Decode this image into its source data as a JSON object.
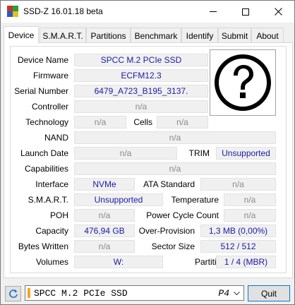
{
  "window": {
    "title": "SSD-Z 16.01.18 beta",
    "icon_colors": [
      "#c0392b",
      "#2e9e3a",
      "#2b5bc0",
      "#e3c021"
    ]
  },
  "tabs": [
    {
      "label": "Device",
      "active": true
    },
    {
      "label": "S.M.A.R.T.",
      "active": false
    },
    {
      "label": "Partitions",
      "active": false
    },
    {
      "label": "Benchmark",
      "active": false
    },
    {
      "label": "Identify",
      "active": false
    },
    {
      "label": "Submit",
      "active": false
    },
    {
      "label": "About",
      "active": false
    }
  ],
  "device": {
    "device_name": {
      "label": "Device Name",
      "value": "SPCC M.2 PCIe SSD"
    },
    "firmware": {
      "label": "Firmware",
      "value": "ECFM12.3"
    },
    "serial_number": {
      "label": "Serial Number",
      "value": "6479_A723_B195_3137."
    },
    "controller": {
      "label": "Controller",
      "value": "n/a"
    },
    "technology": {
      "label": "Technology",
      "value": "n/a"
    },
    "cells": {
      "label": "Cells",
      "value": "n/a"
    },
    "nand": {
      "label": "NAND",
      "value": "n/a"
    },
    "launch_date": {
      "label": "Launch Date",
      "value": "n/a"
    },
    "trim": {
      "label": "TRIM",
      "value": "Unsupported"
    },
    "capabilities": {
      "label": "Capabilities",
      "value": "n/a"
    },
    "interface": {
      "label": "Interface",
      "value": "NVMe"
    },
    "ata_standard": {
      "label": "ATA Standard",
      "value": "n/a"
    },
    "smart": {
      "label": "S.M.A.R.T.",
      "value": "Unsupported"
    },
    "temperature": {
      "label": "Temperature",
      "value": "n/a"
    },
    "poh": {
      "label": "POH",
      "value": "n/a"
    },
    "power_cycle_count": {
      "label": "Power Cycle Count",
      "value": "n/a"
    },
    "capacity": {
      "label": "Capacity",
      "value": "476,94 GB"
    },
    "over_provision": {
      "label": "Over-Provision",
      "value": "1,3 MB (0,00%)"
    },
    "bytes_written": {
      "label": "Bytes Written",
      "value": "n/a"
    },
    "sector_size": {
      "label": "Sector Size",
      "value": "512 / 512"
    },
    "volumes": {
      "label": "Volumes",
      "value": "W:"
    },
    "partitions": {
      "label": "Partitions",
      "value": "1 / 4 (MBR)"
    },
    "image_icon": "question-mark-icon"
  },
  "bottom": {
    "drive_name": "SPCC M.2 PCIe SSD",
    "drive_number": "P4",
    "quit_label": "Quit",
    "refresh_icon": "refresh-icon"
  },
  "colors": {
    "value_text": "#1a1aa8",
    "na_text": "#8a8a8a",
    "accent": "#f5a623"
  }
}
